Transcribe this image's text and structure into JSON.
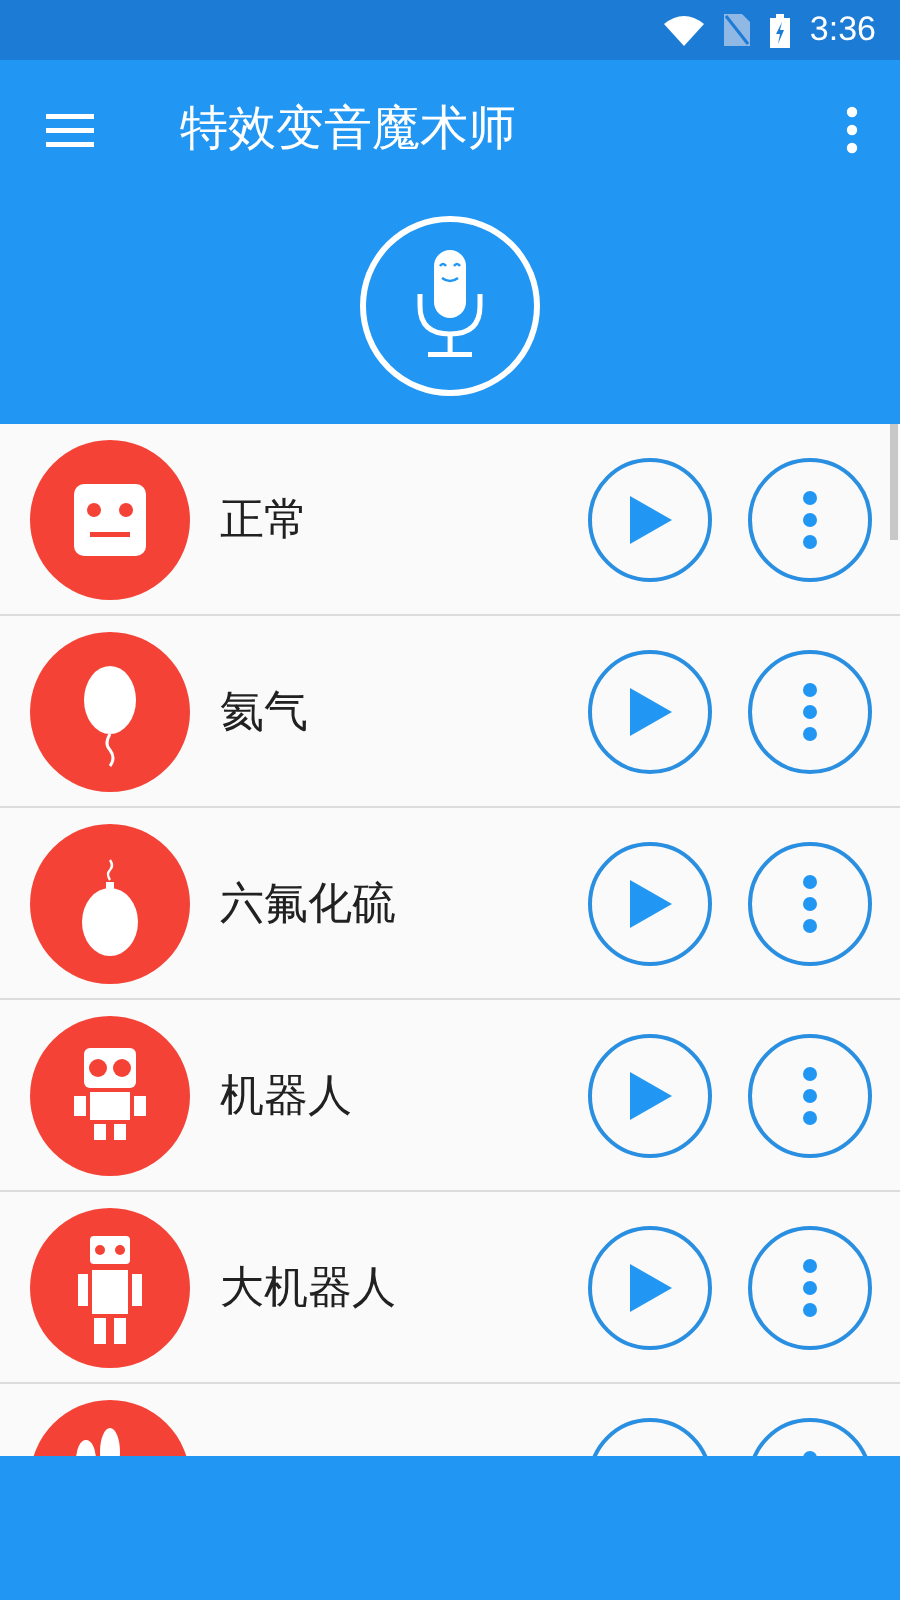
{
  "status_bar": {
    "time": "3:36"
  },
  "app_bar": {
    "title": "特效变音魔术师"
  },
  "effects": [
    {
      "kind": "face",
      "label": "正常"
    },
    {
      "kind": "balloon",
      "label": "氦气"
    },
    {
      "kind": "fuse",
      "label": "六氟化硫"
    },
    {
      "kind": "robot",
      "label": "机器人"
    },
    {
      "kind": "tall",
      "label": "大机器人"
    },
    {
      "kind": "bumps"
    }
  ]
}
